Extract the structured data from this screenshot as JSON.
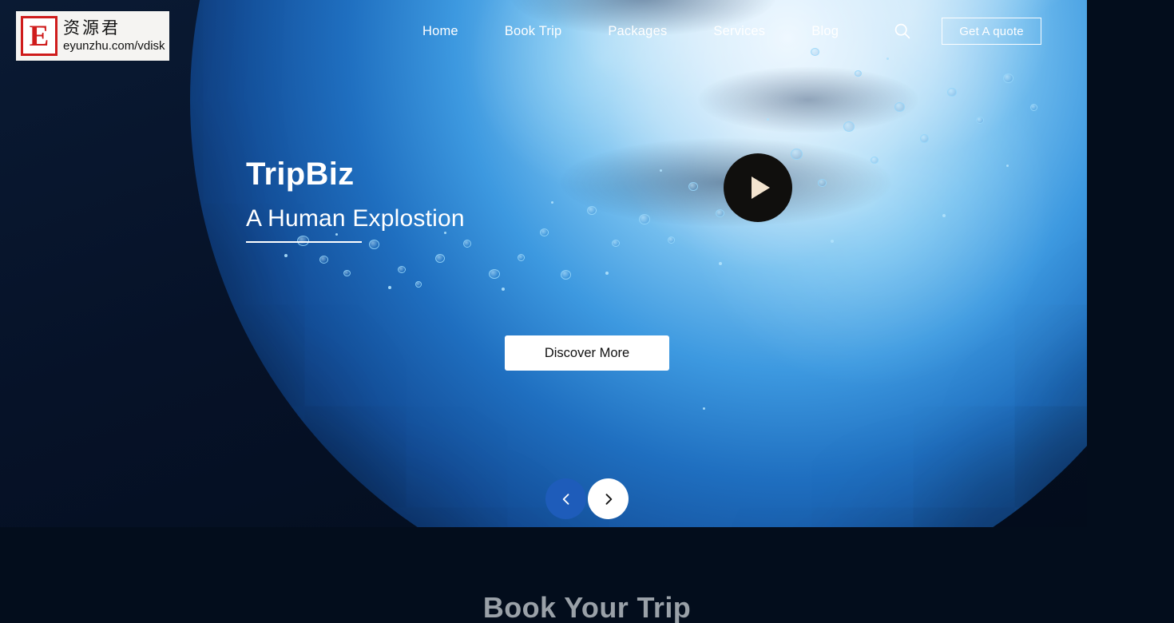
{
  "site": {
    "brand": "TripBiz"
  },
  "nav": {
    "items": [
      {
        "label": "Home"
      },
      {
        "label": "Book Trip"
      },
      {
        "label": "Packages"
      },
      {
        "label": "Services"
      },
      {
        "label": "Blog"
      }
    ],
    "search_icon": "search-icon",
    "quote_button": "Get A quote"
  },
  "hero": {
    "title": "TripBiz",
    "subtitle": "A Human Explostion",
    "discover_button": "Discover More",
    "play_icon": "play-icon",
    "slider": {
      "prev_icon": "chevron-left-icon",
      "next_icon": "chevron-right-icon"
    }
  },
  "book_section": {
    "title": "Book Your Trip"
  },
  "watermark": {
    "letter": "E",
    "chinese": "资源君",
    "url": "eyunzhu.com/vdisk"
  },
  "colors": {
    "page_background": "#030d1c",
    "accent_blue": "#1e5cba",
    "text_white": "#ffffff",
    "section_title": "#9aa1a8",
    "play_button": "#100f0d",
    "play_triangle": "#f3e4cf"
  }
}
